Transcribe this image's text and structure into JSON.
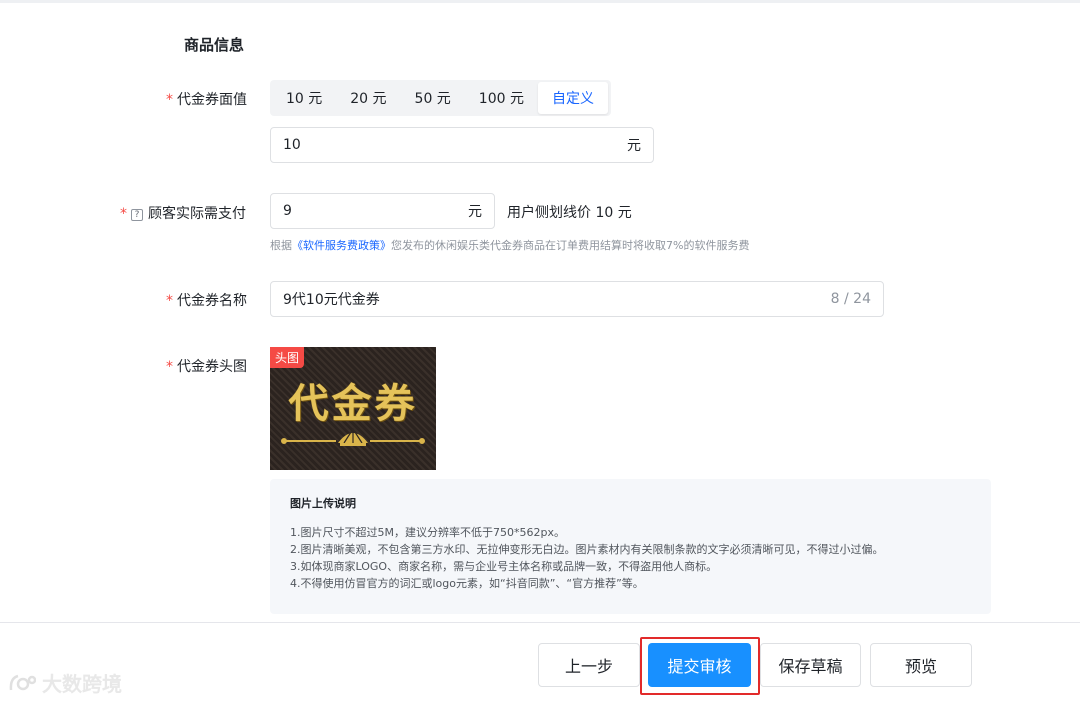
{
  "section_title": "商品信息",
  "face_value": {
    "label": "代金券面值",
    "options": [
      "10 元",
      "20 元",
      "50 元",
      "100 元",
      "自定义"
    ],
    "selected_index": 4,
    "input_value": "10",
    "input_suffix": "元"
  },
  "pay": {
    "label": "顾客实际需支付",
    "help_icon": "?",
    "input_value": "9",
    "input_suffix": "元",
    "strike_price_note": "用户侧划线价 10 元",
    "hint_prefix": "根据",
    "hint_link": "《软件服务费政策》",
    "hint_suffix": "您发布的休闲娱乐类代金券商品在订单费用结算时将收取7%的软件服务费"
  },
  "name": {
    "label": "代金券名称",
    "input_value": "9代10元代金券",
    "counter": "8 / 24"
  },
  "image": {
    "label": "代金券头图",
    "tag": "头图",
    "image_text": "代金券"
  },
  "notice": {
    "title": "图片上传说明",
    "lines": [
      "1.图片尺寸不超过5M，建议分辨率不低于750*562px。",
      "2.图片清晰美观，不包含第三方水印、无拉伸变形无白边。图片素材内有关限制条款的文字必须清晰可见，不得过小过偏。",
      "3.如体现商家LOGO、商家名称，需与企业号主体名称或品牌一致，不得盗用他人商标。",
      "4.不得使用仿冒官方的词汇或logo元素，如“抖音同款”、“官方推荐”等。"
    ]
  },
  "footer": {
    "prev_label": "上一步",
    "submit_label": "提交审核",
    "draft_label": "保存草稿",
    "preview_label": "预览"
  },
  "watermark": {
    "logo_text": "大数跨境"
  },
  "colors": {
    "accent": "#1966ff",
    "primary_button": "#1890ff",
    "required": "#f54a45",
    "highlight": "#e22a2a"
  }
}
